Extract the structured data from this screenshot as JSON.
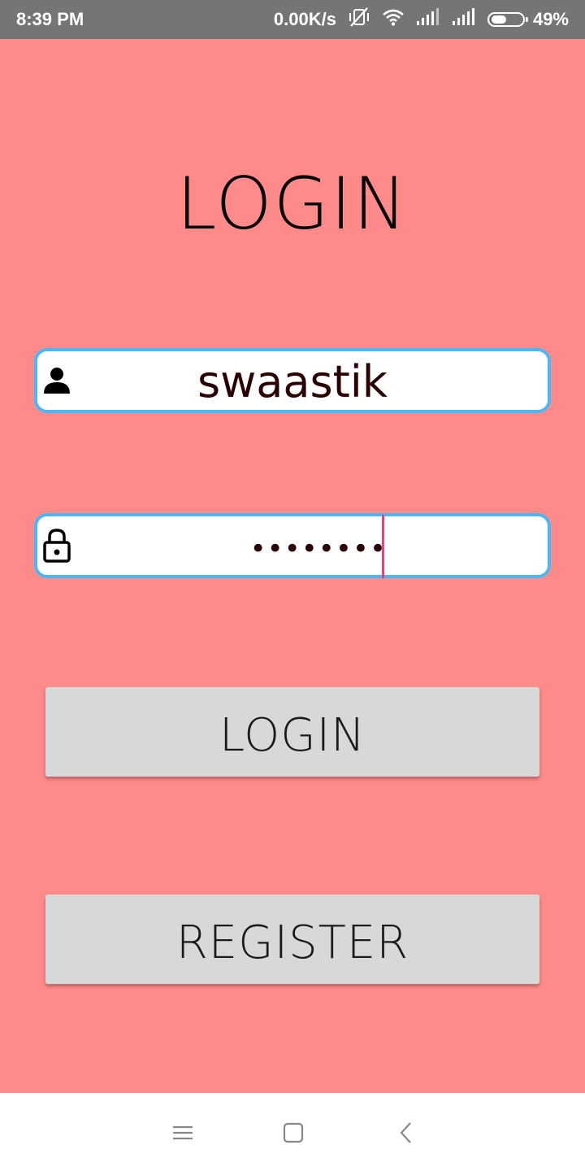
{
  "status_bar": {
    "time": "8:39 PM",
    "speed": "0.00K/s",
    "battery": "49%",
    "battery_level": 0.49,
    "icons": [
      "vibrate-off-icon",
      "wifi-icon",
      "signal-icon",
      "signal-icon",
      "battery-icon"
    ]
  },
  "title": "LOGIN",
  "username": {
    "value": "swaastik",
    "icon": "person-icon"
  },
  "password": {
    "value": "••••••••",
    "icon": "lock-icon"
  },
  "buttons": {
    "login": "LOGIN",
    "register": "REGISTER"
  },
  "nav": {
    "icons": [
      "menu-icon",
      "home-square-icon",
      "back-icon"
    ]
  },
  "colors": {
    "background": "#ff8a8a",
    "field_border": "#4db6f5",
    "button_bg": "#d7d8d8",
    "cursor": "#e0457b",
    "status_bar": "#757575"
  }
}
